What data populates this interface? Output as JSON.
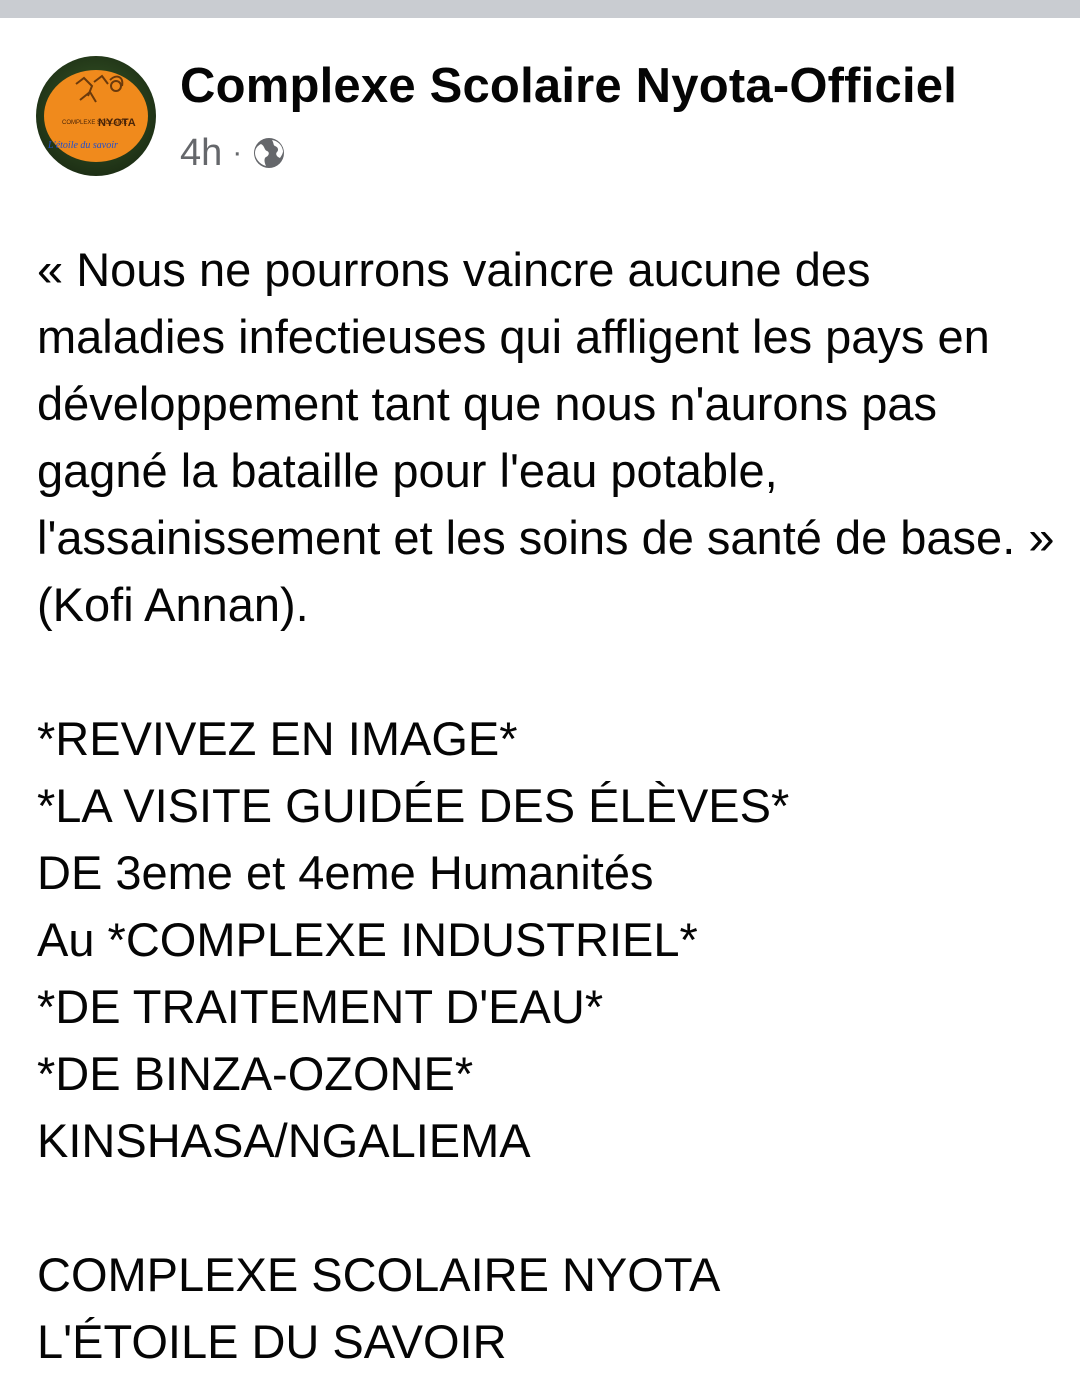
{
  "post": {
    "author": "Complexe Scolaire Nyota-Officiel",
    "timestamp": "4h",
    "separator": "·",
    "privacy_icon": "globe-icon",
    "avatar": {
      "logo_text_top": "COMPLEXE SCOLAIRE",
      "logo_text_name": "NYOTA",
      "logo_tagline": "L'étoile du savoir",
      "colors": {
        "ring": "#2a4220",
        "fill": "#f08a1c",
        "tagline": "#1e4fd0"
      }
    },
    "quote": "« Nous ne pourrons vaincre aucune des maladies infectieuses qui affligent les pays en développement tant que nous n'aurons pas gagné la bataille pour l'eau potable, l'assainissement et les soins de santé de base. » (Kofi Annan).",
    "lines": [
      "*REVIVEZ EN IMAGE*",
      "*LA VISITE GUIDÉE DES ÉLÈVES*",
      "DE 3eme et 4eme Humanités",
      "Au *COMPLEXE INDUSTRIEL*",
      "*DE TRAITEMENT D'EAU*",
      "*DE BINZA-OZONE*",
      "KINSHASA/NGALIEMA"
    ],
    "signature": [
      "COMPLEXE SCOLAIRE NYOTA",
      "L'ÉTOILE DU SAVOIR"
    ]
  },
  "colors": {
    "text": "#050505",
    "meta": "#65676b",
    "top_strip": "#c9ccd1"
  }
}
